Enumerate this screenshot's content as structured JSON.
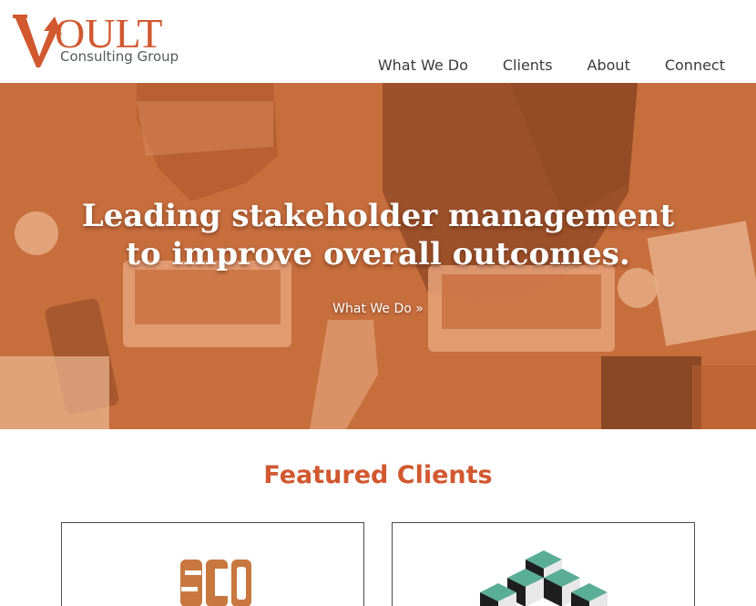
{
  "brand": {
    "logo_word": "OULT",
    "logo_sub": "Consulting Group",
    "logo_text": "VOULT Consulting Group",
    "color": "#d1582f"
  },
  "nav": {
    "items": [
      {
        "label": "What We Do"
      },
      {
        "label": "Clients"
      },
      {
        "label": "About"
      },
      {
        "label": "Connect"
      }
    ]
  },
  "hero": {
    "title_line1": "Leading stakeholder management",
    "title_line2": "to improve overall outcomes.",
    "cta_label": "What We Do »",
    "overlay_color": "#c9713f"
  },
  "featured": {
    "title": "Featured Clients",
    "clients": [
      {
        "logo_text": "SCD",
        "logo_color": "#c8773f"
      },
      {
        "logo_name": "green-cubes-logo",
        "logo_color": "#5aae96"
      }
    ]
  }
}
